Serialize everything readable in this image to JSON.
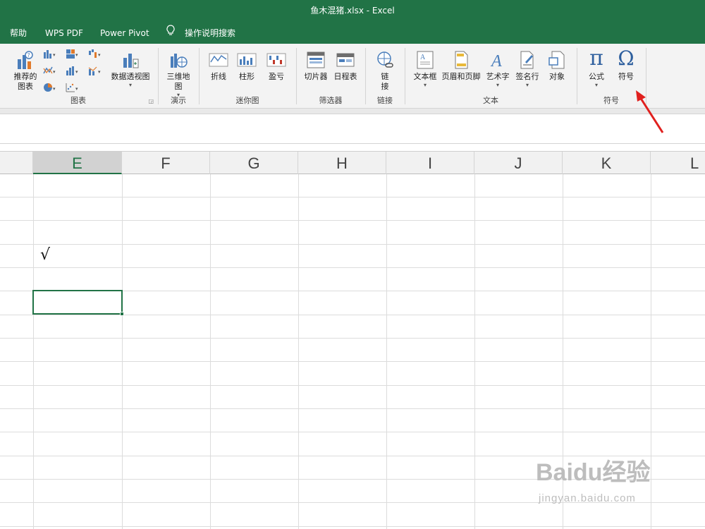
{
  "window": {
    "title": "鱼木混猪.xlsx  -  Excel"
  },
  "menubar": {
    "items": [
      "帮助",
      "WPS PDF",
      "Power Pivot"
    ],
    "tell_me_placeholder": "操作说明搜索",
    "tell_me_icon": "lightbulb-icon"
  },
  "ribbon": {
    "groups": {
      "charts": {
        "label": "图表",
        "recommended_label_1": "推荐的",
        "recommended_label_2": "图表",
        "pivot_chart_label": "数据透视图"
      },
      "tours": {
        "label": "演示",
        "map3d_label_1": "三维地",
        "map3d_label_2": "图"
      },
      "sparklines": {
        "label": "迷你图",
        "line_label": "折线",
        "column_label": "柱形",
        "winloss_label": "盈亏"
      },
      "filters": {
        "label": "筛选器",
        "slicer_label": "切片器",
        "timeline_label": "日程表"
      },
      "links": {
        "label": "链接",
        "link_label_1": "链",
        "link_label_2": "接"
      },
      "text": {
        "label": "文本",
        "textbox_label": "文本框",
        "headerfooter_label": "页眉和页脚",
        "wordart_label": "艺术字",
        "signature_label": "签名行",
        "object_label": "对象"
      },
      "symbols": {
        "label": "符号",
        "equation_label": "公式",
        "symbol_label": "符号",
        "equation_glyph": "π",
        "symbol_glyph": "Ω"
      }
    }
  },
  "sheet": {
    "columns": [
      "E",
      "F",
      "G",
      "H",
      "I",
      "J",
      "K",
      "L"
    ],
    "active_column": "E",
    "cell_value": "√"
  },
  "annotation": {
    "arrow_color": "#e0201e"
  },
  "watermark": {
    "brand": "Baidu经验",
    "url": "jingyan.baidu.com"
  },
  "colors": {
    "accent": "#217346"
  }
}
